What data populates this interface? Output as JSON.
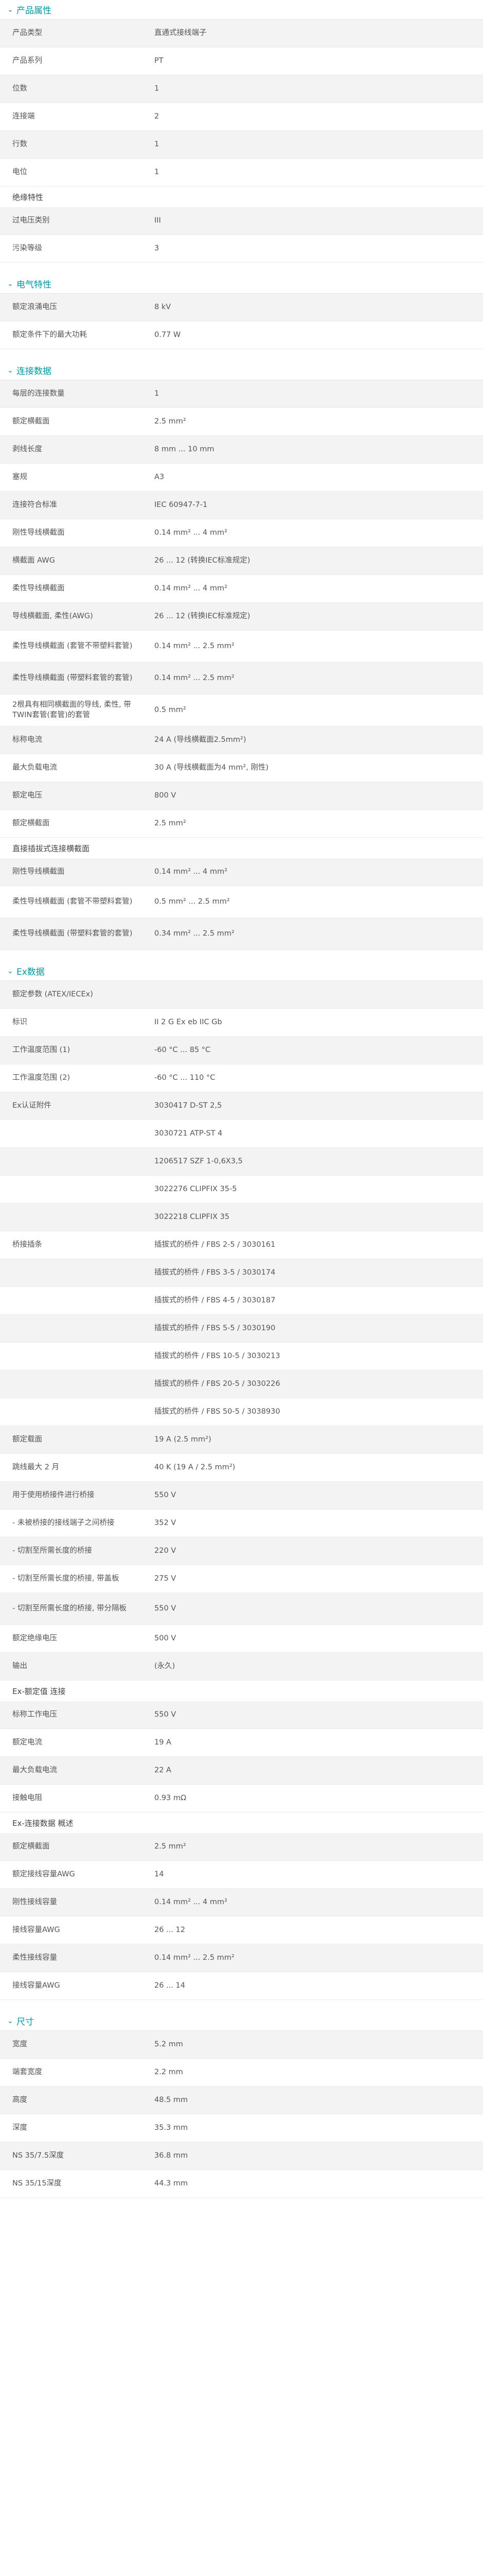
{
  "sections": [
    {
      "title": "产品属性",
      "groups": [
        {
          "title": "",
          "rows": [
            {
              "k": "产品类型",
              "v": "直通式接线端子"
            },
            {
              "k": "产品系列",
              "v": "PT"
            },
            {
              "k": "位数",
              "v": "1"
            },
            {
              "k": "连接端",
              "v": "2"
            },
            {
              "k": "行数",
              "v": "1"
            },
            {
              "k": "电位",
              "v": "1"
            }
          ]
        },
        {
          "title": "绝缘特性",
          "rows": [
            {
              "k": "过电压类别",
              "v": "III"
            },
            {
              "k": "污染等级",
              "v": "3"
            }
          ]
        }
      ]
    },
    {
      "title": "电气特性",
      "groups": [
        {
          "title": "",
          "rows": [
            {
              "k": "额定浪涌电压",
              "v": "8 kV"
            },
            {
              "k": "额定条件下的最大功耗",
              "v": "0.77 W"
            }
          ]
        }
      ]
    },
    {
      "title": "连接数据",
      "groups": [
        {
          "title": "",
          "rows": [
            {
              "k": "每层的连接数量",
              "v": "1"
            },
            {
              "k": "额定横截面",
              "v": "2.5 mm²"
            },
            {
              "k": "剥线长度",
              "v": "8 mm ... 10 mm"
            },
            {
              "k": "塞规",
              "v": "A3"
            },
            {
              "k": "连接符合标准",
              "v": "IEC 60947-7-1"
            },
            {
              "k": "刚性导线横截面",
              "v": "0.14 mm² ... 4 mm²"
            },
            {
              "k": "横截面 AWG",
              "v": "26 ... 12 (转换IEC标准规定)"
            },
            {
              "k": "柔性导线横截面",
              "v": "0.14 mm² ... 4 mm²"
            },
            {
              "k": "导线横截面, 柔性(AWG)",
              "v": "26 ... 12 (转换IEC标准规定)"
            },
            {
              "k": "柔性导线横截面 (套管不带塑料套管)",
              "v": "0.14 mm² ... 2.5 mm²",
              "tall": true
            },
            {
              "k": "柔性导线横截面 (带塑料套管的套管)",
              "v": "0.14 mm² ... 2.5 mm²",
              "tall": true
            },
            {
              "k": "2根具有相同横截面的导线, 柔性, 带TWIN套管(套管)的套管",
              "v": "0.5 mm²",
              "tall": true
            },
            {
              "k": "标称电流",
              "v": "24 A (导线横截面2.5mm²)"
            },
            {
              "k": "最大负载电流",
              "v": "30 A (导线横截面为4 mm², 刚性)"
            },
            {
              "k": "额定电压",
              "v": "800 V"
            },
            {
              "k": "额定横截面",
              "v": "2.5 mm²"
            }
          ]
        },
        {
          "title": "直接插拔式连接横截面",
          "rows": [
            {
              "k": "刚性导线横截面",
              "v": "0.14 mm² ... 4 mm²"
            },
            {
              "k": "柔性导线横截面 (套管不带塑料套管)",
              "v": "0.5 mm² ... 2.5 mm²",
              "tall": true
            },
            {
              "k": "柔性导线横截面 (带塑料套管的套管)",
              "v": "0.34 mm² ... 2.5 mm²",
              "tall": true
            }
          ]
        }
      ]
    },
    {
      "title": "Ex数据",
      "groups": [
        {
          "title": "",
          "rows": [
            {
              "k": "额定参数 (ATEX/IECEx)",
              "v": ""
            },
            {
              "k": "标识",
              "v": "II 2 G Ex eb IIC Gb"
            },
            {
              "k": "工作温度范围 (1)",
              "v": "-60 °C ... 85 °C"
            },
            {
              "k": "工作温度范围 (2)",
              "v": "-60 °C ... 110 °C"
            },
            {
              "k": "Ex认证附件",
              "v": "3030417 D-ST 2,5"
            },
            {
              "k": "",
              "v": "3030721 ATP-ST 4"
            },
            {
              "k": "",
              "v": "1206517 SZF 1-0,6X3,5"
            },
            {
              "k": "",
              "v": "3022276 CLIPFIX 35-5"
            },
            {
              "k": "",
              "v": "3022218 CLIPFIX 35"
            },
            {
              "k": "桥接插条",
              "v": "插拔式的桥件 / FBS 2-5 / 3030161"
            },
            {
              "k": "",
              "v": "插拔式的桥件 / FBS 3-5 / 3030174"
            },
            {
              "k": "",
              "v": "插拔式的桥件 / FBS 4-5 / 3030187"
            },
            {
              "k": "",
              "v": "插拔式的桥件 / FBS 5-5 / 3030190"
            },
            {
              "k": "",
              "v": "插拔式的桥件 / FBS 10-5 / 3030213"
            },
            {
              "k": "",
              "v": "插拔式的桥件 / FBS 20-5 / 3030226"
            },
            {
              "k": "",
              "v": "插拔式的桥件 / FBS 50-5 / 3038930"
            },
            {
              "k": "额定载面",
              "v": "19 A (2.5 mm²)"
            },
            {
              "k": "跳线最大 2 月",
              "v": "40 K (19 A / 2.5 mm²)"
            },
            {
              "k": "用于使用桥接件进行桥接",
              "v": "550 V"
            },
            {
              "k": "- 未被桥接的接线端子之间桥接",
              "v": "352 V"
            },
            {
              "k": "- 切割至所需长度的桥接",
              "v": "220 V"
            },
            {
              "k": "- 切割至所需长度的桥接, 带盖板",
              "v": "275 V"
            },
            {
              "k": "- 切割至所需长度的桥接, 带分隔板",
              "v": "550 V",
              "tall": true
            },
            {
              "k": "额定绝缘电压",
              "v": "500 V"
            },
            {
              "k": "输出",
              "v": "(永久)"
            }
          ]
        },
        {
          "title": "Ex-额定值 连接",
          "rows": [
            {
              "k": "标称工作电压",
              "v": "550 V"
            },
            {
              "k": "额定电流",
              "v": "19 A"
            },
            {
              "k": "最大负载电流",
              "v": "22 A"
            },
            {
              "k": "接触电阻",
              "v": "0.93 mΩ"
            }
          ]
        },
        {
          "title": "Ex-连接数据 概述",
          "rows": [
            {
              "k": "额定横截面",
              "v": "2.5 mm²"
            },
            {
              "k": "额定接线容量AWG",
              "v": "14"
            },
            {
              "k": "刚性接线容量",
              "v": "0.14 mm² ... 4 mm²"
            },
            {
              "k": "接线容量AWG",
              "v": "26 ... 12"
            },
            {
              "k": "柔性接线容量",
              "v": "0.14 mm² ... 2.5 mm²"
            },
            {
              "k": "接线容量AWG",
              "v": "26 ... 14"
            }
          ]
        }
      ]
    },
    {
      "title": "尺寸",
      "groups": [
        {
          "title": "",
          "rows": [
            {
              "k": "宽度",
              "v": "5.2 mm"
            },
            {
              "k": "端套宽度",
              "v": "2.2 mm"
            },
            {
              "k": "高度",
              "v": "48.5 mm"
            },
            {
              "k": "深度",
              "v": "35.3 mm"
            },
            {
              "k": "NS 35/7.5深度",
              "v": "36.8 mm"
            },
            {
              "k": "NS 35/15深度",
              "v": "44.3 mm"
            }
          ]
        }
      ]
    }
  ],
  "colors": {
    "accent": "#0098a1",
    "shade": "#f3f3f3"
  },
  "icons": {
    "section_toggle": "chevron-down-icon"
  }
}
